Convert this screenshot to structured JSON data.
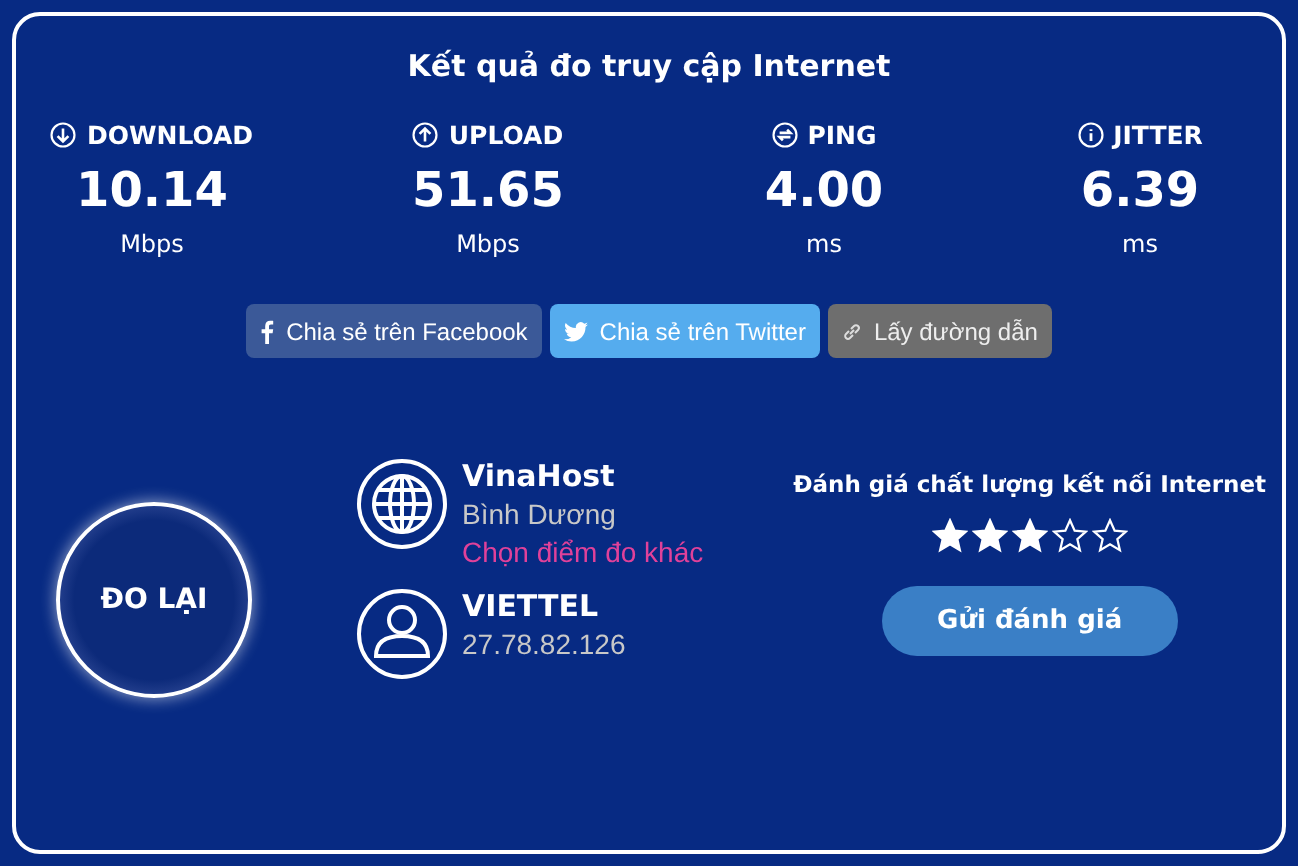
{
  "title": "Kết quả đo truy cập Internet",
  "metrics": [
    {
      "kind": "download",
      "label": "DOWNLOAD",
      "value": "10.14",
      "unit": "Mbps"
    },
    {
      "kind": "upload",
      "label": "UPLOAD",
      "value": "51.65",
      "unit": "Mbps"
    },
    {
      "kind": "ping",
      "label": "PING",
      "value": "4.00",
      "unit": "ms"
    },
    {
      "kind": "jitter",
      "label": "JITTER",
      "value": "6.39",
      "unit": "ms"
    }
  ],
  "share_buttons": [
    {
      "kind": "facebook",
      "label": "Chia sẻ trên Facebook"
    },
    {
      "kind": "twitter",
      "label": "Chia sẻ trên Twitter"
    },
    {
      "kind": "link",
      "label": "Lấy đường dẫn"
    }
  ],
  "restart_button": "ĐO LẠI",
  "server": {
    "name": "VinaHost",
    "location": "Bình Dương",
    "change_link": "Chọn điểm đo khác"
  },
  "client": {
    "isp": "VIETTEL",
    "ip": "27.78.82.126"
  },
  "rating": {
    "title": "Đánh giá chất lượng kết nối Internet",
    "stars": 3,
    "submit": "Gửi đánh giá"
  }
}
